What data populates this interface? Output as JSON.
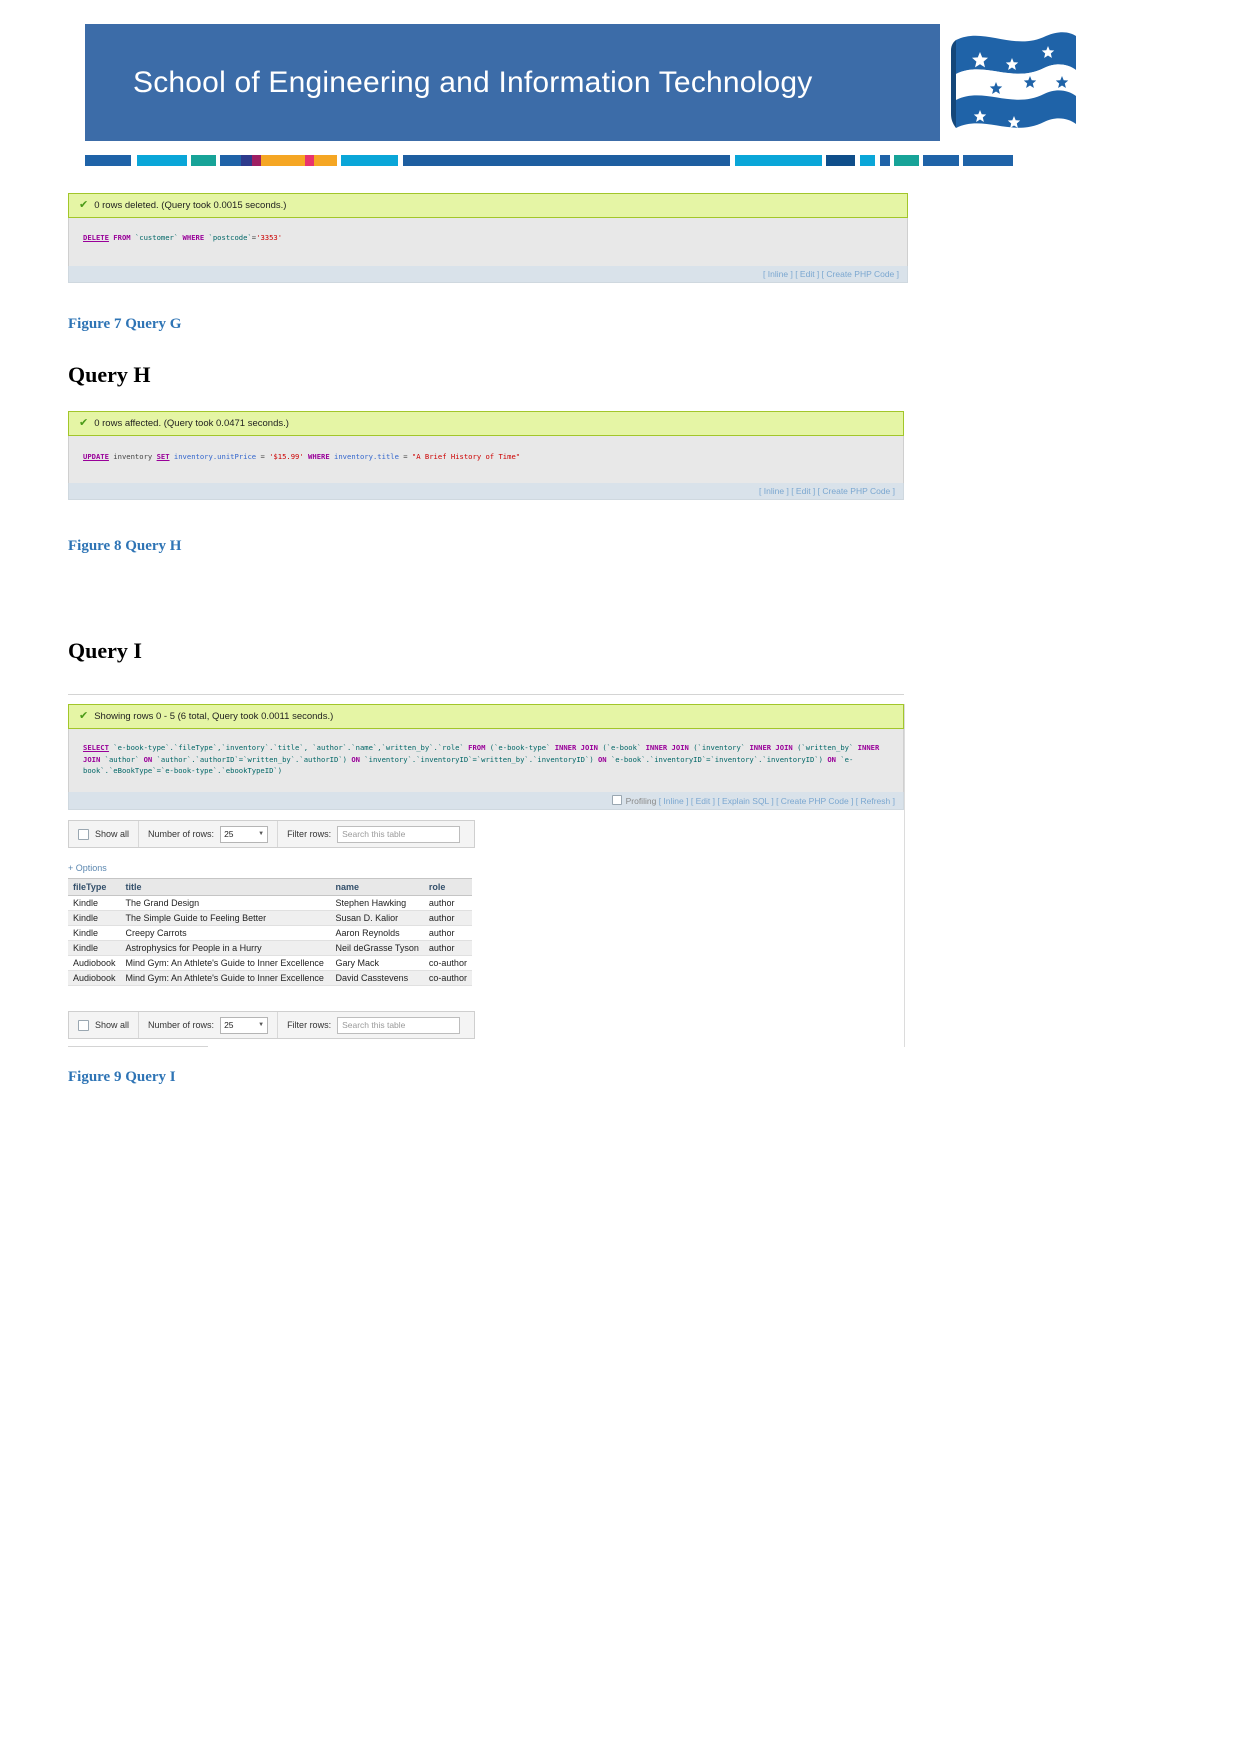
{
  "header": {
    "title": "School of Engineering and Information Technology",
    "banner_color": "#3c6ca8",
    "flag_alt": "federation-university-flag-logo",
    "strip_colors": [
      "#1f63a8",
      "#1f63a8",
      "#0aa6d8",
      "#0aa6d8",
      "#17a398",
      "#2e3a8c",
      "#9e1f63",
      "#f5a623",
      "#f5a623",
      "#e8336e",
      "#f5a623",
      "#0aa6d8",
      "#1f63a8",
      "#1f63a8",
      "#0aa6d8",
      "#0f4e8a",
      "#0aa6d8",
      "#1f63a8",
      "#17a398",
      "#1f63a8",
      "#0aa6d8",
      "#1f63a8"
    ]
  },
  "figures": {
    "g": {
      "notice": "0 rows deleted. (Query took 0.0015 seconds.)",
      "sql": {
        "keyword": "DELETE",
        "from": "FROM",
        "table": "`customer`",
        "where": "WHERE",
        "condition_col": "`postcode`",
        "eq": "=",
        "value": "'3353'"
      },
      "links": [
        "[ Inline ]",
        "[ Edit ]",
        "[ Create PHP Code ]"
      ],
      "caption": "Figure 7 Query G"
    },
    "h": {
      "section_title": "Query H",
      "notice": "0 rows affected. (Query took 0.0471 seconds.)",
      "sql": {
        "keyword": "UPDATE",
        "target": "inventory",
        "set": "SET",
        "set_col": "inventory.unitPrice",
        "eq1": "=",
        "set_val": "'$15.99'",
        "where": "WHERE",
        "where_col": "inventory.title",
        "eq2": "=",
        "where_val": "\"A Brief History of Time\""
      },
      "links": [
        "[ Inline ]",
        "[ Edit ]",
        "[ Create PHP Code ]"
      ],
      "caption": "Figure 8 Query H"
    },
    "i": {
      "section_title": "Query I",
      "notice": "Showing rows 0 - 5 (6 total, Query took 0.0011 seconds.)",
      "sql_line1_a": "SELECT",
      "sql_line1_b": "`e-book-type`.`fileType`,`inventory`.`title`, `author`.`name`,`written_by`.`role`",
      "sql_line1_c": "FROM",
      "sql_line1_d": "(`e-book-type`",
      "sql_line1_e": "INNER JOIN",
      "sql_line1_f": "(`e-book`",
      "sql_line1_g": "INNER JOIN",
      "sql_line1_h": "(`inventory`",
      "sql_line1_i": "INNER JOIN",
      "sql_line1_j": "(`written_by`",
      "sql_line1_k": "INNER JOIN",
      "sql_line1_l": "`author`",
      "sql_line2_a": "ON",
      "sql_line2_b": "`author`.`authorID`=`written_by`.`authorID`)",
      "sql_line2_c": "ON",
      "sql_line2_d": "`inventory`.`inventoryID`=`written_by`.`inventoryID`)",
      "sql_line2_e": "ON",
      "sql_line2_f": "`e-book`.`inventoryID`=`inventory`.`inventoryID`)",
      "sql_line2_g": "ON",
      "sql_line2_h": "`e-book`.`eBookType`=`e-book-type`.`ebookTypeID`)",
      "profiling_label": "Profiling",
      "links": [
        "[ Inline ]",
        "[ Edit ]",
        "[ Explain SQL ]",
        "[ Create PHP Code ]",
        "[ Refresh ]"
      ],
      "toolbar": {
        "show_all": "Show all",
        "number_of_rows": "Number of rows:",
        "rows_value": "25",
        "filter_rows": "Filter rows:",
        "search_placeholder": "Search this table"
      },
      "options_link": "+ Options",
      "table": {
        "columns": [
          "fileType",
          "title",
          "name",
          "role"
        ],
        "rows": [
          [
            "Kindle",
            "The Grand Design",
            "Stephen Hawking",
            "author"
          ],
          [
            "Kindle",
            "The Simple Guide to Feeling Better",
            "Susan D. Kalior",
            "author"
          ],
          [
            "Kindle",
            "Creepy Carrots",
            "Aaron Reynolds",
            "author"
          ],
          [
            "Kindle",
            "Astrophysics for People in a Hurry",
            "Neil deGrasse Tyson",
            "author"
          ],
          [
            "Audiobook",
            "Mind Gym: An Athlete's Guide to Inner Excellence",
            "Gary Mack",
            "co-author"
          ],
          [
            "Audiobook",
            "Mind Gym: An Athlete's Guide to Inner Excellence",
            "David Casstevens",
            "co-author"
          ]
        ]
      },
      "caption": "Figure 9 Query I"
    }
  }
}
